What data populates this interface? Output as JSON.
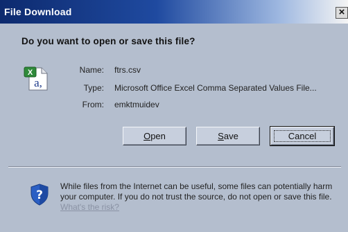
{
  "window": {
    "title": "File Download",
    "close_glyph": "×"
  },
  "dialog": {
    "question": "Do you want to open or save this file?",
    "file_icon": "excel-csv-file-icon",
    "fields": {
      "name_label": "Name:",
      "name_value": "ftrs.csv",
      "type_label": "Type:",
      "type_value": "Microsoft Office Excel Comma Separated Values File...",
      "from_label": "From:",
      "from_value": "emktmuidev"
    },
    "buttons": {
      "open_label_rest": "pen",
      "open_mnemonic": "O",
      "save_label_rest": "ave",
      "save_mnemonic": "S",
      "cancel_label": "Cancel"
    }
  },
  "warning": {
    "icon": "shield-question-icon",
    "text": "While files from the Internet can be useful, some files can potentially harm your computer. If you do not trust the source, do not open or save this file.",
    "link": "What's the risk?"
  },
  "colors": {
    "background": "#b4bece",
    "titlebar_start": "#0d2a6e",
    "titlebar_end": "#f4f4f4",
    "button_face": "#c7cfdd",
    "link": "#8a92a4"
  }
}
